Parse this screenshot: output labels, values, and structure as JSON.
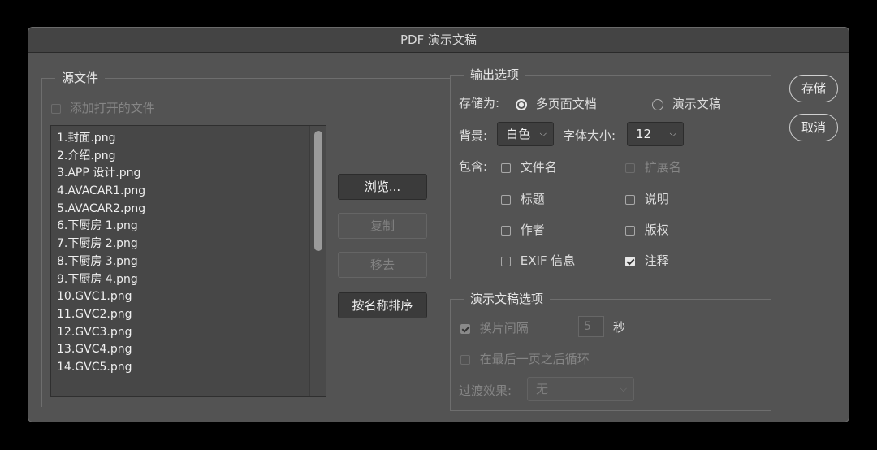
{
  "window": {
    "title": "PDF 演示文稿"
  },
  "source": {
    "group_title": "源文件",
    "add_open_files": {
      "label": "添加打开的文件",
      "checked": false,
      "enabled": false
    },
    "files": [
      "1.封面.png",
      "2.介绍.png",
      "3.APP 设计.png",
      "4.AVACAR1.png",
      "5.AVACAR2.png",
      "6.下厨房 1.png",
      "7.下厨房 2.png",
      "8.下厨房 3.png",
      "9.下厨房 4.png",
      "10.GVC1.png",
      "11.GVC2.png",
      "12.GVC3.png",
      "13.GVC4.png",
      "14.GVC5.png"
    ],
    "browse_label": "浏览...",
    "duplicate_label": "复制",
    "remove_label": "移去",
    "sort_label": "按名称排序"
  },
  "output": {
    "group_title": "输出选项",
    "save_as_label": "存储为:",
    "save_options": [
      {
        "label": "多页面文档",
        "selected": true
      },
      {
        "label": "演示文稿",
        "selected": false
      }
    ],
    "background_label": "背景:",
    "background_value": "白色",
    "font_size_label": "字体大小:",
    "font_size_value": "12",
    "include_label": "包含:",
    "include": {
      "filename": {
        "label": "文件名",
        "checked": false,
        "enabled": true
      },
      "extension": {
        "label": "扩展名",
        "checked": false,
        "enabled": false
      },
      "title": {
        "label": "标题",
        "checked": false,
        "enabled": true
      },
      "description": {
        "label": "说明",
        "checked": false,
        "enabled": true
      },
      "author": {
        "label": "作者",
        "checked": false,
        "enabled": true
      },
      "copyright": {
        "label": "版权",
        "checked": false,
        "enabled": true
      },
      "exif": {
        "label": "EXIF 信息",
        "checked": false,
        "enabled": true
      },
      "annotations": {
        "label": "注释",
        "checked": true,
        "enabled": true
      }
    }
  },
  "presentation": {
    "group_title": "演示文稿选项",
    "advance": {
      "label": "换片间隔",
      "checked": true,
      "enabled": false
    },
    "seconds_value": "5",
    "seconds_unit": "秒",
    "loop": {
      "label": "在最后一页之后循环",
      "checked": false,
      "enabled": false
    },
    "transition_label": "过渡效果:",
    "transition_value": "无"
  },
  "actions": {
    "save_label": "存储",
    "cancel_label": "取消"
  },
  "icons": {
    "dropdown": "chevron-down-icon"
  }
}
